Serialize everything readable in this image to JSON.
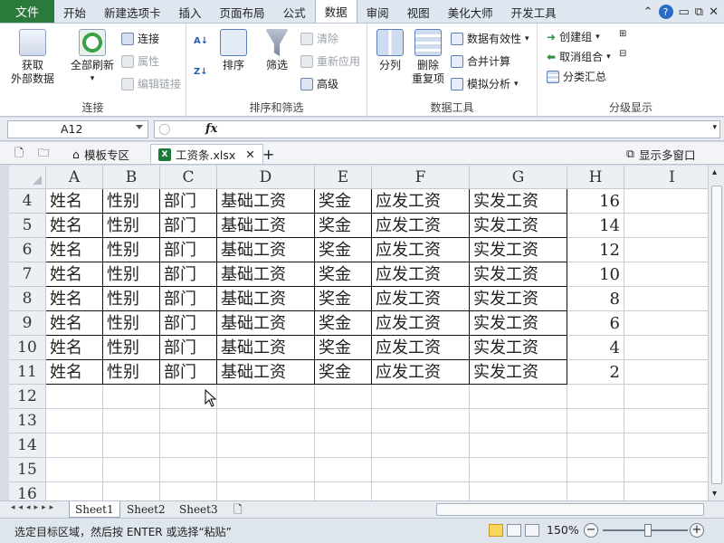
{
  "menu": {
    "file": "文件",
    "tabs": [
      "开始",
      "新建选项卡",
      "插入",
      "页面布局",
      "公式",
      "数据",
      "审阅",
      "视图",
      "美化大师",
      "开发工具"
    ],
    "active_tab": "数据"
  },
  "ribbon": {
    "get_external": "获取\n外部数据",
    "refresh_all": "全部刷新",
    "connections": "连接",
    "properties": "属性",
    "edit_links": "编辑链接",
    "group_connections": "连接",
    "sort": "排序",
    "filter": "筛选",
    "clear": "清除",
    "reapply": "重新应用",
    "advanced": "高级",
    "group_sort_filter": "排序和筛选",
    "text_to_columns": "分列",
    "remove_duplicates": "删除\n重复项",
    "data_validation": "数据有效性",
    "consolidate": "合并计算",
    "what_if": "模拟分析",
    "group_data_tools": "数据工具",
    "group": "创建组",
    "ungroup": "取消组合",
    "subtotal": "分类汇总",
    "group_outline": "分级显示"
  },
  "formula_bar": {
    "name_box": "A12",
    "fx": "fx",
    "formula": ""
  },
  "doc_tabs": {
    "templates": "模板专区",
    "file": "工资条.xlsx",
    "show_windows": "显示多窗口"
  },
  "grid": {
    "columns": [
      "A",
      "B",
      "C",
      "D",
      "E",
      "F",
      "G",
      "H",
      "I"
    ],
    "rows": [
      {
        "num": "4",
        "cells": [
          "姓名",
          "性别",
          "部门",
          "基础工资",
          "奖金",
          "应发工资",
          "实发工资",
          "16"
        ]
      },
      {
        "num": "5",
        "cells": [
          "姓名",
          "性别",
          "部门",
          "基础工资",
          "奖金",
          "应发工资",
          "实发工资",
          "14"
        ]
      },
      {
        "num": "6",
        "cells": [
          "姓名",
          "性别",
          "部门",
          "基础工资",
          "奖金",
          "应发工资",
          "实发工资",
          "12"
        ]
      },
      {
        "num": "7",
        "cells": [
          "姓名",
          "性别",
          "部门",
          "基础工资",
          "奖金",
          "应发工资",
          "实发工资",
          "10"
        ]
      },
      {
        "num": "8",
        "cells": [
          "姓名",
          "性别",
          "部门",
          "基础工资",
          "奖金",
          "应发工资",
          "实发工资",
          "8"
        ]
      },
      {
        "num": "9",
        "cells": [
          "姓名",
          "性别",
          "部门",
          "基础工资",
          "奖金",
          "应发工资",
          "实发工资",
          "6"
        ]
      },
      {
        "num": "10",
        "cells": [
          "姓名",
          "性别",
          "部门",
          "基础工资",
          "奖金",
          "应发工资",
          "实发工资",
          "4"
        ]
      },
      {
        "num": "11",
        "cells": [
          "姓名",
          "性别",
          "部门",
          "基础工资",
          "奖金",
          "应发工资",
          "实发工资",
          "2"
        ]
      },
      {
        "num": "12",
        "cells": []
      },
      {
        "num": "13",
        "cells": []
      },
      {
        "num": "14",
        "cells": []
      },
      {
        "num": "15",
        "cells": []
      },
      {
        "num": "16",
        "cells": []
      }
    ]
  },
  "sheets": [
    "Sheet1",
    "Sheet2",
    "Sheet3"
  ],
  "active_sheet": "Sheet1",
  "status": {
    "message": "选定目标区域，然后按 ENTER 或选择“粘贴”",
    "zoom": "150%"
  },
  "colors": {
    "file_tab": "#2a7a3c",
    "excel_green": "#1e7a3a"
  }
}
